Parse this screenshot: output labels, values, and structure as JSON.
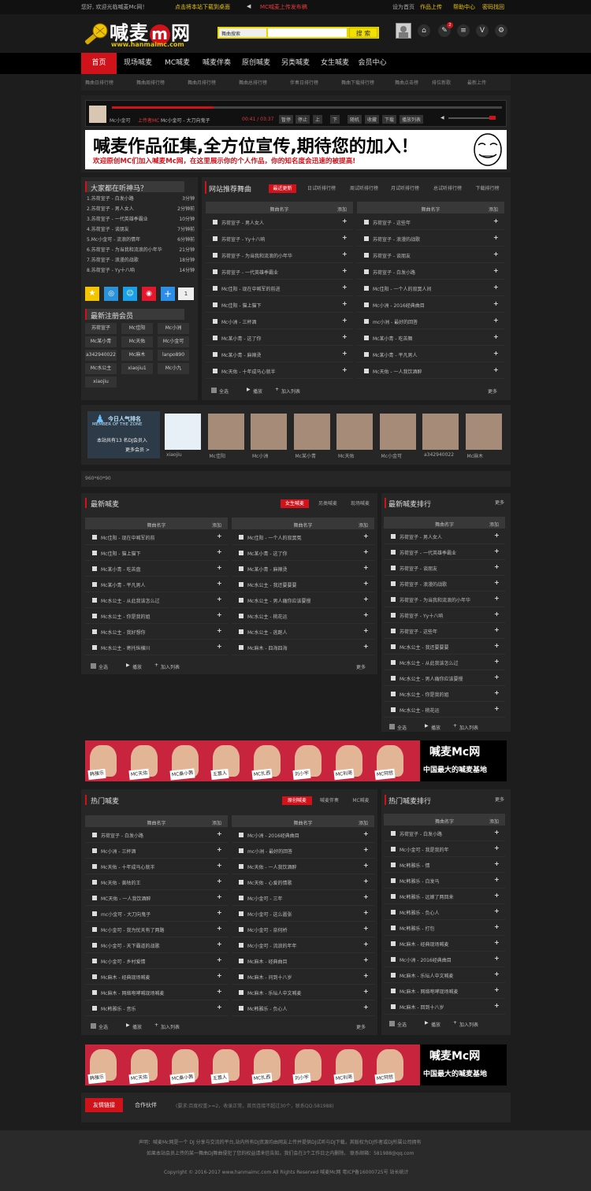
{
  "topbar": {
    "welcome": "您好, 欢迎光临喊麦Mc网！",
    "ad1": "点击将本站下载到桌面",
    "ad2": "MC喊麦上传发布稿",
    "links": [
      "设为首页",
      "作品上传",
      "帮助中心",
      "密码找回"
    ]
  },
  "header": {
    "logo_text": "喊麦",
    "logo_m": "m",
    "logo_wang": "网",
    "logo_url": "www.hanmaimc.com",
    "search_select": "舞曲搜索",
    "search_placeholder": "",
    "search_button": "搜 索",
    "badge": "2"
  },
  "nav": {
    "items": [
      "首页",
      "现场喊麦",
      "MC喊麦",
      "喊麦伴奏",
      "原创喊麦",
      "另类喊麦",
      "女生喊麦",
      "会员中心"
    ]
  },
  "subnav": [
    "舞曲日排行榜",
    "舞曲周排行榜",
    "舞曲月排行榜",
    "舞曲总排行榜",
    "伴奏日排行榜",
    "舞曲下载排行榜",
    "舞曲下载排行榜",
    "舞曲月排行榜",
    "舞曲点击榜",
    "排位新歌",
    "好评新歌",
    "最新上传"
  ],
  "player": {
    "user": "Mc小金可",
    "status": "上传者MC",
    "title": "Mc小金可 - 大刀向鬼子",
    "time": "00:41 / 03:37",
    "buttons": [
      "暂停",
      "停止",
      "上",
      "下",
      "随机",
      "收藏",
      "下载",
      "播放列表"
    ]
  },
  "banner1": {
    "line1": "喊麦作品征集,全方位宣传,期待您的加入！",
    "line2": "欢迎原创MC们加入喊麦Mc网，在这里展示你的个人作品，你的知名度会迅速的被提高!"
  },
  "listening": {
    "title": "大家都在听神马？",
    "items": [
      {
        "text": "1.苏荷宣子 - 白发小路",
        "time": "3分钟"
      },
      {
        "text": "2.苏荷宣子 - 男人女人",
        "time": "2分钟前"
      },
      {
        "text": "3.苏荷宣子 - 一代英雄季霸业",
        "time": "10分钟"
      },
      {
        "text": "4.苏荷宣子 - 谈朋友",
        "time": "7分钟前"
      },
      {
        "text": "5.Mc小金可 - 流浪的情年",
        "time": "6分钟前"
      },
      {
        "text": "6.苏荷宣子 - 为当我和流浪的小年华",
        "time": "21分钟"
      },
      {
        "text": "7.苏荷宣子 - 浪漫的战歌",
        "time": "18分钟"
      },
      {
        "text": "8.苏荷宣子 - Yy十八响",
        "time": "14分钟"
      }
    ],
    "share_count": "1"
  },
  "new_members": {
    "title": "最新注册会员",
    "names": [
      "苏荷宣子",
      "Mc佳阳",
      "Mc小洲",
      "Mc某小青",
      "Mc天佑",
      "Mc小金可",
      "a342940022",
      "Mc麻木",
      "lanpo890",
      "Mc水公主",
      "xiaojiu1",
      "Mc小九",
      "xiaojiu"
    ]
  },
  "recommend": {
    "title": "网站推荐舞曲",
    "tabs": [
      "最近更新",
      "日试听排行榜",
      "周试听排行榜",
      "月试听排行榜",
      "总试听排行榜",
      "下载排行榜"
    ],
    "col_header": "舞曲名字",
    "col_add": "添加",
    "left": [
      "苏荷宣子 - 男人女人",
      "苏荷宣子 - Yy十八响",
      "苏荷宣子 - 为当我和流浪的小年华",
      "苏荷宣子 - 一代英雄季霸业",
      "Mc佳阳 - 现在中喊军的前进",
      "Mc佳阳 - 猫上猫下",
      "Mc小洲 - 三杯酒",
      "Mc某小青 - 这了你",
      "Mc某小青 - 麻辣烫",
      "Mc天佑 - 十年成马心就半"
    ],
    "right": [
      "苏荷宣子 - 这些年",
      "苏荷宣子 - 浪漫的战歌",
      "苏荷宣子 - 谈朋友",
      "苏荷宣子 - 白发小路",
      "Mc佳阳 - 一个人的寂寞人间",
      "Mc小洲 - 2016经典曲目",
      "mc小洲 - 最好的回答",
      "Mc某小青 - 吃苦舞",
      "Mc某小青 - 平凡男人",
      "Mc天佑 - 一人我饮酒醉"
    ],
    "footer": [
      "全选",
      "播放",
      "加入列表",
      "更多"
    ]
  },
  "zone": {
    "title": "今日人气排名",
    "subtitle": "MEMBER OF THE ZONE",
    "count_text": "本站共有13 名DJ会员入",
    "more": "更多会员 >",
    "members": [
      "xiaojiu",
      "Mc佳阳",
      "Mc小洲",
      "Mc某小青",
      "Mc天佑",
      "Mc小金可",
      "a342940022",
      "Mc麻木"
    ]
  },
  "ad_placeholder": "960*60*90",
  "latest": {
    "title": "最新喊麦",
    "tabs": [
      "女生喊麦",
      "另类喊麦",
      "现场喊麦"
    ],
    "col_header": "舞曲名字",
    "col_add": "添加",
    "left": [
      "Mc佳阳 - 现在中喊军的前",
      "Mc佳阳 - 猫上猫下",
      "Mc某小青 - 吃苦盘",
      "Mc某小青 - 平凡男人",
      "Mc水公主 - 从此我该怎么过",
      "Mc水公主 - 你是我的姐",
      "Mc水公主 - 我好想你",
      "Mc水公主 - 寄托纵横川"
    ],
    "right": [
      "Mc佳阳 - 一个人的寂寞冤",
      "Mc某小青 - 这了你",
      "Mc某小青 - 麻辣烫",
      "Mc水公主 - 我还要要要",
      "Mc水公主 - 男人痛你应该要慢",
      "Mc水公主 - 桃花运",
      "Mc水公主 - 逃跑人",
      "Mc麻木 - 四海四海"
    ],
    "footer": [
      "全选",
      "播放",
      "加入列表",
      "更多"
    ]
  },
  "latest_rank": {
    "title": "最新喊麦排行",
    "more": "更多",
    "col_header": "舞曲名字",
    "col_add": "添加",
    "items": [
      "苏荷宣子 - 男人女人",
      "苏荷宣子 - 一代英雄季霸业",
      "苏荷宣子 - 谈朋友",
      "苏荷宣子 - 浪漫的战歌",
      "苏荷宣子 - 为当我和流浪的小年华",
      "苏荷宣子 - Yy十八响",
      "苏荷宣子 - 这些年",
      "Mc水公主 - 我还要要要",
      "Mc水公主 - 从此我该怎么过",
      "Mc水公主 - 男人痛你应该要慢",
      "Mc水公主 - 你是我的姐",
      "Mc水公主 - 桃花运"
    ],
    "footer": [
      "全选",
      "播放",
      "加入列表"
    ]
  },
  "banner2": {
    "line1": "喊麦Mc网",
    "line2": "中国最大的喊麦基地",
    "names": [
      "韩雅乐",
      "MC天佑",
      "MC桑小茜",
      "王嚣人",
      "MC扎西",
      "刘小宇",
      "MC利哥",
      "MC阿哲"
    ]
  },
  "hot": {
    "title": "热门喊麦",
    "tabs": [
      "原创喊麦",
      "喊麦伴奏",
      "MC喊麦"
    ],
    "col_header": "舞曲名字",
    "col_add": "添加",
    "left": [
      "苏荷宣子 - 白发小路",
      "Mc小洲 - 三杯酒",
      "Mc天佑 - 十年成马心就半",
      "Mc天佑 - 黄枯的王",
      "MC天佑 - 一人我饮酒醉",
      "mc小金可 - 大刀向鬼子",
      "Mc小金可 - 我为忧天有了两路",
      "Mc小金可 - 天下霸道的战歌",
      "Mc小金可 - 乡村爱情",
      "Mc麻木 - 经典现场喊麦",
      "Mc麻木 - 网络咆哮喊现场喊麦",
      "Mc韩雅乐 - 音乐"
    ],
    "right": [
      "Mc小洲 - 2016经典曲目",
      "mc小洲 - 最好的回答",
      "Mc天佑 - 一人我饮酒醉",
      "Mc天佑 - 心爱的情歌",
      "Mc小金可 - 三年",
      "Mc小金可 - 这么嚣张",
      "Mc小金可 - 奈何桥",
      "Mc小金可 - 流浪的年年",
      "Mc麻木 - 经典曲目",
      "Mc麻木 - 问到十八岁",
      "Mc麻木 - 乐坛人中文喊麦",
      "Mc韩雅乐 - 负心人"
    ],
    "footer": [
      "全选",
      "播放",
      "加入列表",
      "更多"
    ]
  },
  "hot_rank": {
    "title": "热门喊麦排行",
    "more": "更多",
    "col_header": "舞曲名字",
    "col_add": "添加",
    "items": [
      "苏荷宣子 - 白发小路",
      "Mc小金可 - 我是我的年",
      "Mc韩雅乐 - 情",
      "Mc韩雅乐 - 白发马",
      "Mc韩雅乐 - 远嫁了两回来",
      "Mc韩雅乐 - 负心人",
      "Mc韩雅乐 - 打包",
      "Mc麻木 - 经典现场喊麦",
      "Mc小洲 - 2016经典曲目",
      "Mc麻木 - 乐坛人中文喊麦",
      "Mc麻木 - 网络咆哮现场喊麦",
      "Mc麻木 - 回到十八岁"
    ],
    "footer": [
      "全选",
      "播放",
      "加入列表"
    ]
  },
  "banner3": {
    "line1": "喊麦Mc网",
    "line2": "中国最大的喊麦基地",
    "names": [
      "韩雅乐",
      "MC天佑",
      "MC桑小茜",
      "王嚣人",
      "MC扎西",
      "刘小宇",
      "MC利哥",
      "MC阿哲"
    ]
  },
  "links": {
    "tabs": [
      "友情链接",
      "合作伙伴"
    ],
    "note": "(要求:百度权重>=2，收录正常，首页连接不超过30个，联系QQ:581988)"
  },
  "footer": {
    "line1": "声明：喊麦Mc网是一个 DJ 分享与交流的平台,站内所有DJ资源均由网友上传并提供DJ试听与DJ下载，其版权为DJ作者或DJ所属公司拥有",
    "line2": "如果本站会员上传的某一舞曲DJ舞曲侵犯了您的权益请来信告知，我们会在3个工作日之内删除。 联系邮箱：581988@qq.com",
    "line3": "Copyright © 2016-2017 www.hanmaimc.com All Rights Reserved 喊麦Mc网 粤ICP备16000725号 站长统计"
  },
  "colors": {
    "accent": "#d0121b",
    "yellow": "#e8d800",
    "bg": "#1d1d1d"
  }
}
